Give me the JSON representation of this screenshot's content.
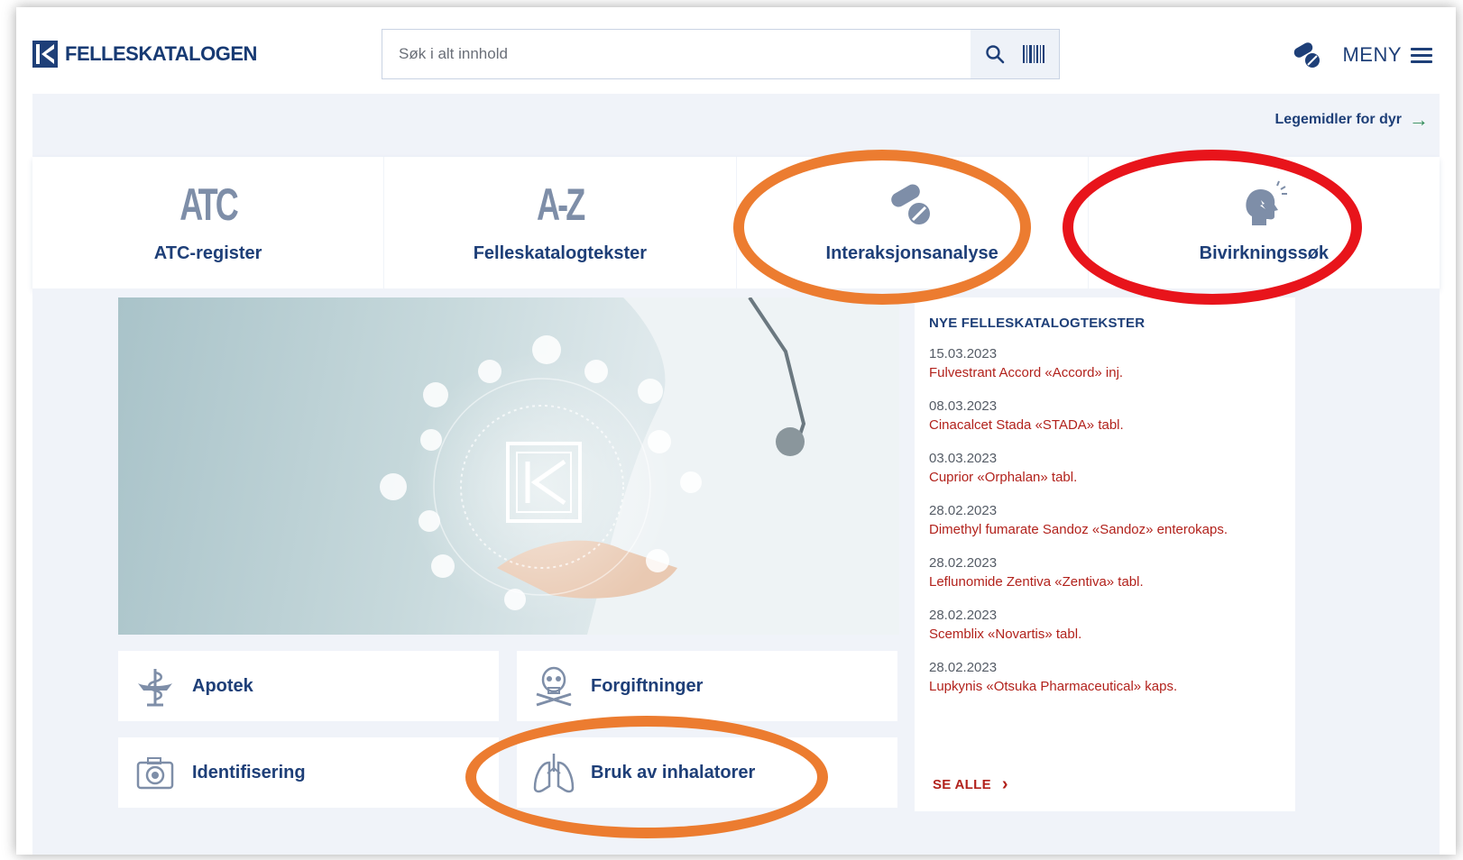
{
  "header": {
    "logo_text": "FELLESKATALOGEN",
    "search_placeholder": "Søk i alt innhold",
    "menu_label": "MENY"
  },
  "subbar": {
    "animal_link": "Legemidler for dyr"
  },
  "tiles": [
    {
      "icon_text": "ATC",
      "label": "ATC-register"
    },
    {
      "icon_text": "A-Z",
      "label": "Felleskatalogtekster"
    },
    {
      "icon": "pills-icon",
      "label": "Interaksjonsanalyse"
    },
    {
      "icon": "head-icon",
      "label": "Bivirkningssøk"
    }
  ],
  "news": {
    "title": "NYE FELLESKATALOGTEKSTER",
    "items": [
      {
        "date": "15.03.2023",
        "text": "Fulvestrant Accord «Accord» inj."
      },
      {
        "date": "08.03.2023",
        "text": "Cinacalcet Stada «STADA» tabl."
      },
      {
        "date": "03.03.2023",
        "text": "Cuprior «Orphalan» tabl."
      },
      {
        "date": "28.02.2023",
        "text": "Dimethyl fumarate Sandoz «Sandoz» enterokaps."
      },
      {
        "date": "28.02.2023",
        "text": "Leflunomide Zentiva «Zentiva» tabl."
      },
      {
        "date": "28.02.2023",
        "text": "Scemblix «Novartis» tabl."
      },
      {
        "date": "28.02.2023",
        "text": "Lupkynis «Otsuka Pharmaceutical» kaps."
      }
    ],
    "see_all": "SE ALLE"
  },
  "quicklinks": [
    {
      "icon": "pharmacy-icon",
      "label": "Apotek"
    },
    {
      "icon": "poison-icon",
      "label": "Forgiftninger"
    },
    {
      "icon": "camera-icon",
      "label": "Identifisering"
    },
    {
      "icon": "lungs-icon",
      "label": "Bruk av inhalatorer"
    }
  ],
  "colors": {
    "brand": "#1e3f78",
    "link_red": "#b2221c",
    "annotation_orange": "#ec7c30",
    "annotation_red": "#e8141b"
  }
}
